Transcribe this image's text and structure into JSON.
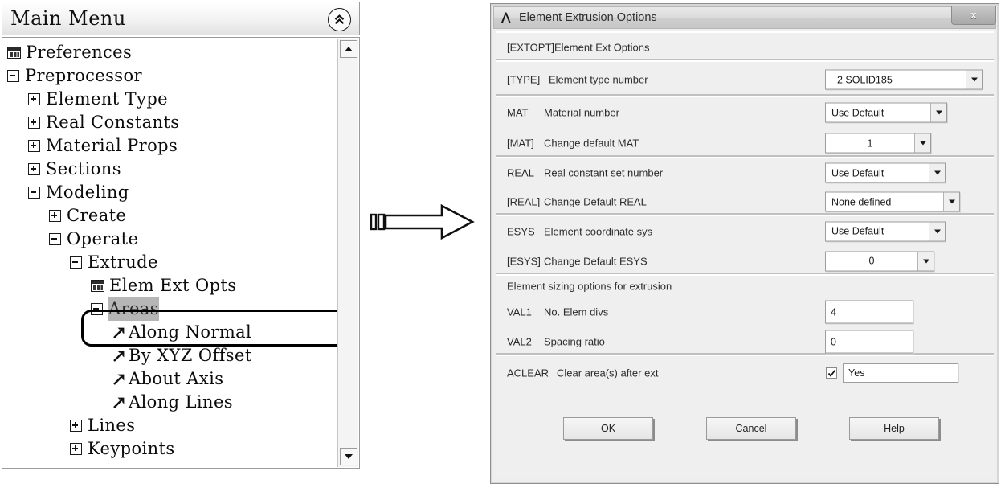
{
  "tree": {
    "title": "Main Menu",
    "collapse_icon": "double-chevron-up-icon",
    "items": [
      {
        "label": "Preferences",
        "indent": 0,
        "marker": "dialog",
        "state": "none",
        "selected": false
      },
      {
        "label": "Preprocessor",
        "indent": 0,
        "marker": "toggle",
        "state": "minus",
        "selected": false
      },
      {
        "label": "Element Type",
        "indent": 1,
        "marker": "toggle",
        "state": "plus",
        "selected": false
      },
      {
        "label": "Real Constants",
        "indent": 1,
        "marker": "toggle",
        "state": "plus",
        "selected": false
      },
      {
        "label": "Material Props",
        "indent": 1,
        "marker": "toggle",
        "state": "plus",
        "selected": false
      },
      {
        "label": "Sections",
        "indent": 1,
        "marker": "toggle",
        "state": "plus",
        "selected": false
      },
      {
        "label": "Modeling",
        "indent": 1,
        "marker": "toggle",
        "state": "minus",
        "selected": false
      },
      {
        "label": "Create",
        "indent": 2,
        "marker": "toggle",
        "state": "plus",
        "selected": false
      },
      {
        "label": "Operate",
        "indent": 2,
        "marker": "toggle",
        "state": "minus",
        "selected": false
      },
      {
        "label": "Extrude",
        "indent": 3,
        "marker": "toggle",
        "state": "minus",
        "selected": false
      },
      {
        "label": "Elem Ext Opts",
        "indent": 4,
        "marker": "dialog",
        "state": "none",
        "selected": false
      },
      {
        "label": "Areas",
        "indent": 4,
        "marker": "toggle",
        "state": "minus",
        "selected": true
      },
      {
        "label": "Along Normal",
        "indent": 5,
        "marker": "arrow",
        "state": "none",
        "selected": false
      },
      {
        "label": "By XYZ Offset",
        "indent": 5,
        "marker": "arrow",
        "state": "none",
        "selected": false
      },
      {
        "label": "About Axis",
        "indent": 5,
        "marker": "arrow",
        "state": "none",
        "selected": false
      },
      {
        "label": "Along Lines",
        "indent": 5,
        "marker": "arrow",
        "state": "none",
        "selected": false
      },
      {
        "label": "Lines",
        "indent": 3,
        "marker": "toggle",
        "state": "plus",
        "selected": false
      },
      {
        "label": "Keypoints",
        "indent": 3,
        "marker": "toggle",
        "state": "plus",
        "selected": false
      }
    ],
    "highlight_label": "Elem Ext Opts",
    "scrollbar": {
      "up_icon": "scroll-up-arrow-icon",
      "down_icon": "scroll-down-arrow-icon"
    }
  },
  "arrow": {
    "icon": "right-arrow-callout"
  },
  "dialog": {
    "title": "Element Extrusion Options",
    "logo_icon": "ansys-lambda-icon",
    "close_label": "x",
    "header_row": {
      "code": "[EXTOPT]",
      "text": "Element Ext Options"
    },
    "groups": [
      {
        "rows": [
          {
            "code": "[TYPE]",
            "text": "Element type number",
            "control": "combo",
            "value": "2   SOLID185",
            "align": "left"
          }
        ]
      },
      {
        "rows": [
          {
            "code": "MAT",
            "text": "Material number",
            "control": "combo",
            "value": "Use Default",
            "align": "left"
          },
          {
            "code": "[MAT]",
            "text": "Change default MAT",
            "control": "combo",
            "value": "1",
            "align": "center"
          }
        ]
      },
      {
        "rows": [
          {
            "code": "REAL",
            "text": "Real constant set number",
            "control": "combo",
            "value": "Use Default",
            "align": "left"
          },
          {
            "code": "[REAL]",
            "text": "Change Default REAL",
            "control": "combo",
            "value": "None defined",
            "align": "left"
          }
        ]
      },
      {
        "rows": [
          {
            "code": "ESYS",
            "text": "Element coordinate sys",
            "control": "combo",
            "value": "Use Default",
            "align": "left"
          },
          {
            "code": "[ESYS]",
            "text": "Change Default ESYS",
            "control": "combo",
            "value": "0",
            "align": "center"
          }
        ]
      },
      {
        "caption": "Element sizing options for extrusion",
        "rows": [
          {
            "code": "VAL1",
            "text": "No. Elem divs",
            "control": "text",
            "value": "4"
          },
          {
            "code": "VAL2",
            "text": "Spacing ratio",
            "control": "text",
            "value": "0"
          }
        ]
      },
      {
        "rows": [
          {
            "code": "ACLEAR",
            "text": "Clear area(s) after ext",
            "control": "checkbox-text",
            "value": "Yes",
            "checked": true
          }
        ]
      }
    ],
    "buttons": [
      {
        "label": "OK"
      },
      {
        "label": "Cancel"
      },
      {
        "label": "Help"
      }
    ]
  },
  "labels": {
    "extopt_code": "[EXTOPT]",
    "extopt_text": "Element Ext Options",
    "type_code": "[TYPE]",
    "type_text": "Element type number",
    "type_value": "2   SOLID185",
    "mat_code": "MAT",
    "mat_text": "Material number",
    "mat_value": "Use Default",
    "mat2_code": "[MAT]",
    "mat2_text": "Change default MAT",
    "mat2_value": "1",
    "real_code": "REAL",
    "real_text": "Real constant set number",
    "real_value": "Use Default",
    "real2_code": "[REAL]",
    "real2_text": "Change Default REAL",
    "real2_value": "None defined",
    "esys_code": "ESYS",
    "esys_text": "Element coordinate sys",
    "esys_value": "Use Default",
    "esys2_code": "[ESYS]",
    "esys2_text": "Change Default ESYS",
    "esys2_value": "0",
    "sizing_caption": "Element sizing options for extrusion",
    "val1_code": "VAL1",
    "val1_text": "No. Elem divs",
    "val1_value": "4",
    "val2_code": "VAL2",
    "val2_text": "Spacing ratio",
    "val2_value": "0",
    "aclear_code": "ACLEAR",
    "aclear_text": "Clear area(s) after ext",
    "aclear_value": "Yes",
    "ok": "OK",
    "cancel": "Cancel",
    "help": "Help"
  },
  "colors": {
    "dialog_bg": "#efefef",
    "titlebar": "#d6d6d6",
    "selection": "#b6b6b6",
    "text": "#1c1c1c"
  }
}
